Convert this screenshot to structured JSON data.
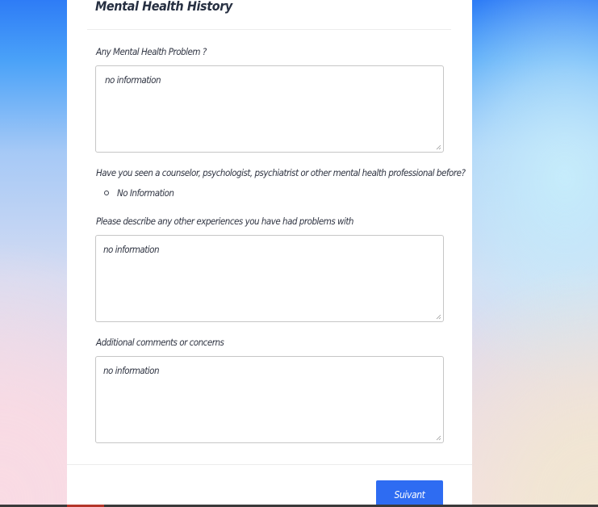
{
  "section": {
    "title": "Mental Health History"
  },
  "fields": [
    {
      "label": "Any Mental Health Problem ?",
      "value": "no information"
    },
    {
      "label": "Please describe any other experiences you have had problems with",
      "value": "no information"
    },
    {
      "label": "Additional comments or concerns",
      "value": "no information"
    }
  ],
  "question": {
    "label": "Have you seen a counselor, psychologist, psychiatrist or other mental health professional before?",
    "answer": "No Information"
  },
  "actions": {
    "next_label": "Suivant"
  },
  "colors": {
    "accent": "#2e6cf2",
    "text": "#2f3442",
    "card": "#ffffff"
  }
}
